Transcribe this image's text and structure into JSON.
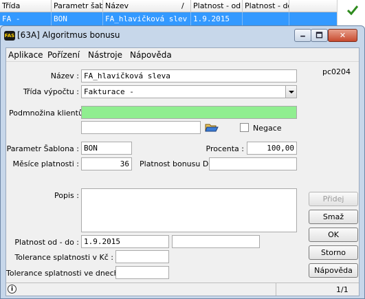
{
  "grid": {
    "headers": [
      "Třída",
      "Parametr šab.",
      "Název",
      "/",
      "Platnost - od",
      "Platnost - do"
    ],
    "selected_row": [
      "FA -",
      "BON",
      "FA_hlavičková slev",
      "1.9.2015",
      ""
    ]
  },
  "window": {
    "app_icon_text": "FAS",
    "title": "[63A] Algoritmus bonusu",
    "min_label": "🗕",
    "max_label": "🗖",
    "close_label": "✕"
  },
  "menu": [
    "Aplikace",
    "Pořízení",
    "Nástroje",
    "Nápověda"
  ],
  "form": {
    "code": "pc0204",
    "nazev_label": "Název :",
    "nazev_value": "FA_hlavičková sleva",
    "trida_label": "Třída výpočtu :",
    "trida_value": "Fakturace -",
    "podmnozina_label": "Podmnožina klientů :",
    "podmnozina_value": "",
    "extra_value": "",
    "negace_label": "Negace",
    "parametr_label": "Parametr Šablona :",
    "parametr_value": "BON",
    "procenta_label": "Procenta :",
    "procenta_value": "100,00",
    "mesice_label": "Měsíce platnosti :",
    "mesice_value": "36",
    "platnost_bonusu_label": "Platnost bonusu DO:",
    "platnost_bonusu_value": "",
    "popis_label": "Popis :",
    "popis_value": "",
    "platnost_label": "Platnost od - do :",
    "platnost_od": "1.9.2015",
    "platnost_do": "",
    "tol_kc_label": "Tolerance splatnosti v Kč :",
    "tol_kc_value": "",
    "tol_dny_label": "Tolerance splatnosti ve dnech :",
    "tol_dny_value": ""
  },
  "buttons": {
    "pridej": "Přidej",
    "smaz": "Smaž",
    "ok": "OK",
    "storno": "Storno",
    "napoveda": "Nápověda"
  },
  "status": {
    "info_icon": "i",
    "page": "1/1"
  }
}
